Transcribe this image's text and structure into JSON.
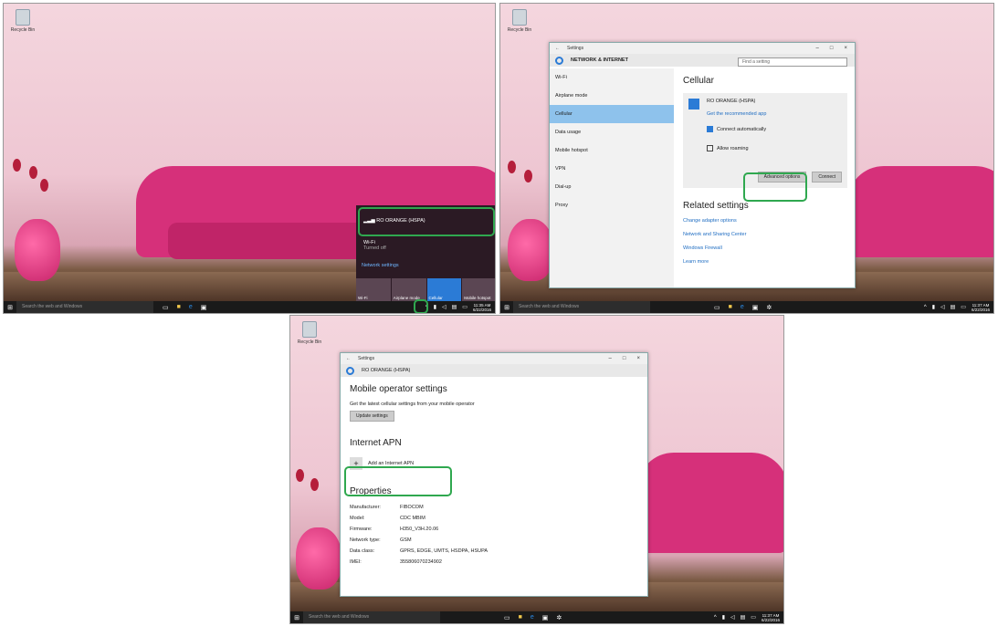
{
  "desktop": {
    "recycle_bin": "Recycle Bin"
  },
  "taskbar": {
    "search_placeholder": "Search the web and Windows",
    "clock_time_1": "11:35 AM",
    "clock_date_1": "6/22/2016",
    "clock_time_2": "11:37 AM",
    "clock_date_2": "6/22/2016",
    "clock_time_3": "11:37 AM",
    "clock_date_3": "6/22/2016"
  },
  "flyout": {
    "network_name": "RO ORANGE (HSPA)",
    "wifi_label": "Wi-Fi",
    "wifi_status": "Turned off",
    "network_settings_link": "Network settings",
    "tiles": [
      "Wi-Fi",
      "Airplane mode",
      "Cellular",
      "Mobile hotspot"
    ]
  },
  "settings_window": {
    "title": "Settings",
    "header": "NETWORK & INTERNET",
    "search_placeholder": "Find a setting",
    "nav": [
      "Wi-Fi",
      "Airplane mode",
      "Cellular",
      "Data usage",
      "Mobile hotspot",
      "VPN",
      "Dial-up",
      "Proxy"
    ],
    "section_title": "Cellular",
    "network_name": "RO ORANGE (HSPA)",
    "recommended_app_link": "Get the recommended app",
    "connect_auto_label": "Connect automatically",
    "allow_roaming_label": "Allow roaming",
    "advanced_button": "Advanced options",
    "connect_button": "Connect",
    "related_title": "Related settings",
    "related_links": [
      "Change adapter options",
      "Network and Sharing Center",
      "Windows Firewall",
      "Learn more"
    ]
  },
  "advanced_window": {
    "title": "Settings",
    "header": "RO ORANGE (HSPA)",
    "operator_title": "Mobile operator settings",
    "operator_desc": "Get the latest cellular settings from your mobile operator",
    "update_button": "Update settings",
    "apn_title": "Internet APN",
    "add_apn_label": "Add an Internet APN",
    "properties_title": "Properties",
    "properties": [
      {
        "label": "Manufacturer:",
        "value": "FIBOCOM"
      },
      {
        "label": "Model:",
        "value": "CDC MBIM"
      },
      {
        "label": "Firmware:",
        "value": "H350_V3H.20.06"
      },
      {
        "label": "Network type:",
        "value": "GSM"
      },
      {
        "label": "Data class:",
        "value": "GPRS, EDGE, UMTS, HSDPA, HSUPA"
      },
      {
        "label": "IMEI:",
        "value": "355806070234902"
      }
    ]
  }
}
